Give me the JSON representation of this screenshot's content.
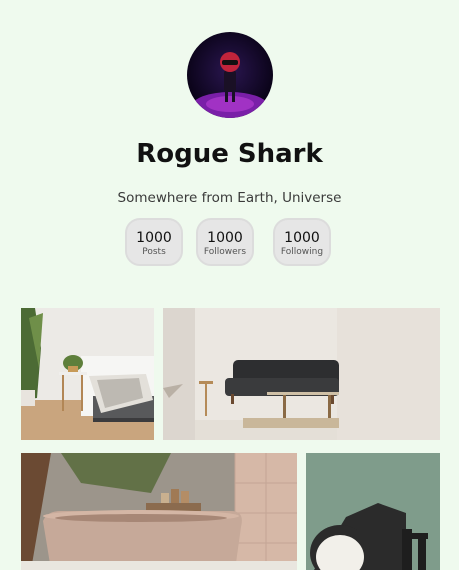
{
  "profile": {
    "name": "Rogue Shark",
    "location": "Somewhere from Earth, Universe"
  },
  "stats": [
    {
      "value": "1000",
      "label": "Posts"
    },
    {
      "value": "1000",
      "label": "Followers"
    },
    {
      "value": "1000",
      "label": "Following"
    }
  ],
  "gallery": [
    {
      "subject": "bedroom with plant and side table"
    },
    {
      "subject": "living room with dark sofa"
    },
    {
      "subject": "bathroom with freestanding tub"
    },
    {
      "subject": "black desk lamp on green wall"
    }
  ]
}
